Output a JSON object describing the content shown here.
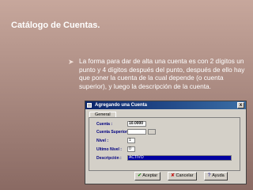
{
  "slide": {
    "title": "Catálogo de Cuentas.",
    "bullet": "La forma para dar de alta una cuenta es con 2 dígitos un punto y 4 dígitos después del punto, después de ello hay que poner la cuenta de la cual depende (o cuenta superior), y luego la descripción de la cuenta."
  },
  "dialog": {
    "title": "Agregando una Cuenta",
    "close_label": "x",
    "tab_general": "General",
    "labels": {
      "cuenta": "Cuenta :",
      "cuenta_superior": "Cuenta Superior :",
      "nivel": "Nivel :",
      "ultimo_nivel": "Ultimo Nivel :",
      "descripcion": "Descripción :"
    },
    "values": {
      "cuenta": "10.0000",
      "cuenta_superior": "",
      "nivel": "1",
      "ultimo_nivel": "0",
      "descripcion": "ACTIVO"
    },
    "buttons": {
      "aceptar": "Aceptar",
      "cancelar": "Cancelar",
      "ayuda": "Ayuda"
    }
  }
}
